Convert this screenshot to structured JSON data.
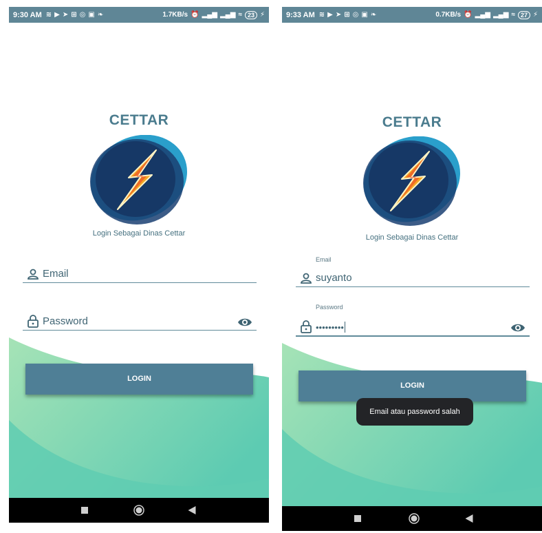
{
  "screens": [
    {
      "status_bar": {
        "time": "9:30 AM",
        "network_speed": "1.7KB/s",
        "battery": "23",
        "notification_icons": [
          "hotspot-icon",
          "youtube-icon",
          "telegram-icon",
          "data-icon",
          "instagram-icon",
          "app-icon",
          "twitter-icon"
        ]
      },
      "app_title": "CETTAR",
      "subtitle": "Login Sebagai Dinas Cettar",
      "email": {
        "label": "",
        "value": "",
        "placeholder": "Email"
      },
      "password": {
        "label": "",
        "value": "",
        "placeholder": "Password"
      },
      "login_label": "LOGIN",
      "toast": ""
    },
    {
      "status_bar": {
        "time": "9:33 AM",
        "network_speed": "0.7KB/s",
        "battery": "27",
        "notification_icons": [
          "hotspot-icon",
          "youtube-icon",
          "telegram-icon",
          "data-icon",
          "instagram-icon",
          "app-icon",
          "twitter-icon"
        ]
      },
      "app_title": "CETTAR",
      "subtitle": "Login Sebagai Dinas Cettar",
      "email": {
        "label": "Email",
        "value": "suyanto",
        "placeholder": ""
      },
      "password": {
        "label": "Password",
        "value": "•••••••••",
        "placeholder": ""
      },
      "login_label": "LOGIN",
      "toast": "Email atau password salah"
    }
  ],
  "colors": {
    "status_bar": "#5f8696",
    "accent": "#4f7f96",
    "title": "#4b7c8e",
    "wave_light": "#9fdeb4",
    "wave_dark": "#5fccb1",
    "logo_outer": "#2a9fcb",
    "logo_inner": "#1a3f72",
    "bolt": "#f5a623",
    "toast_bg": "#232427",
    "nav_bar": "#000000"
  }
}
